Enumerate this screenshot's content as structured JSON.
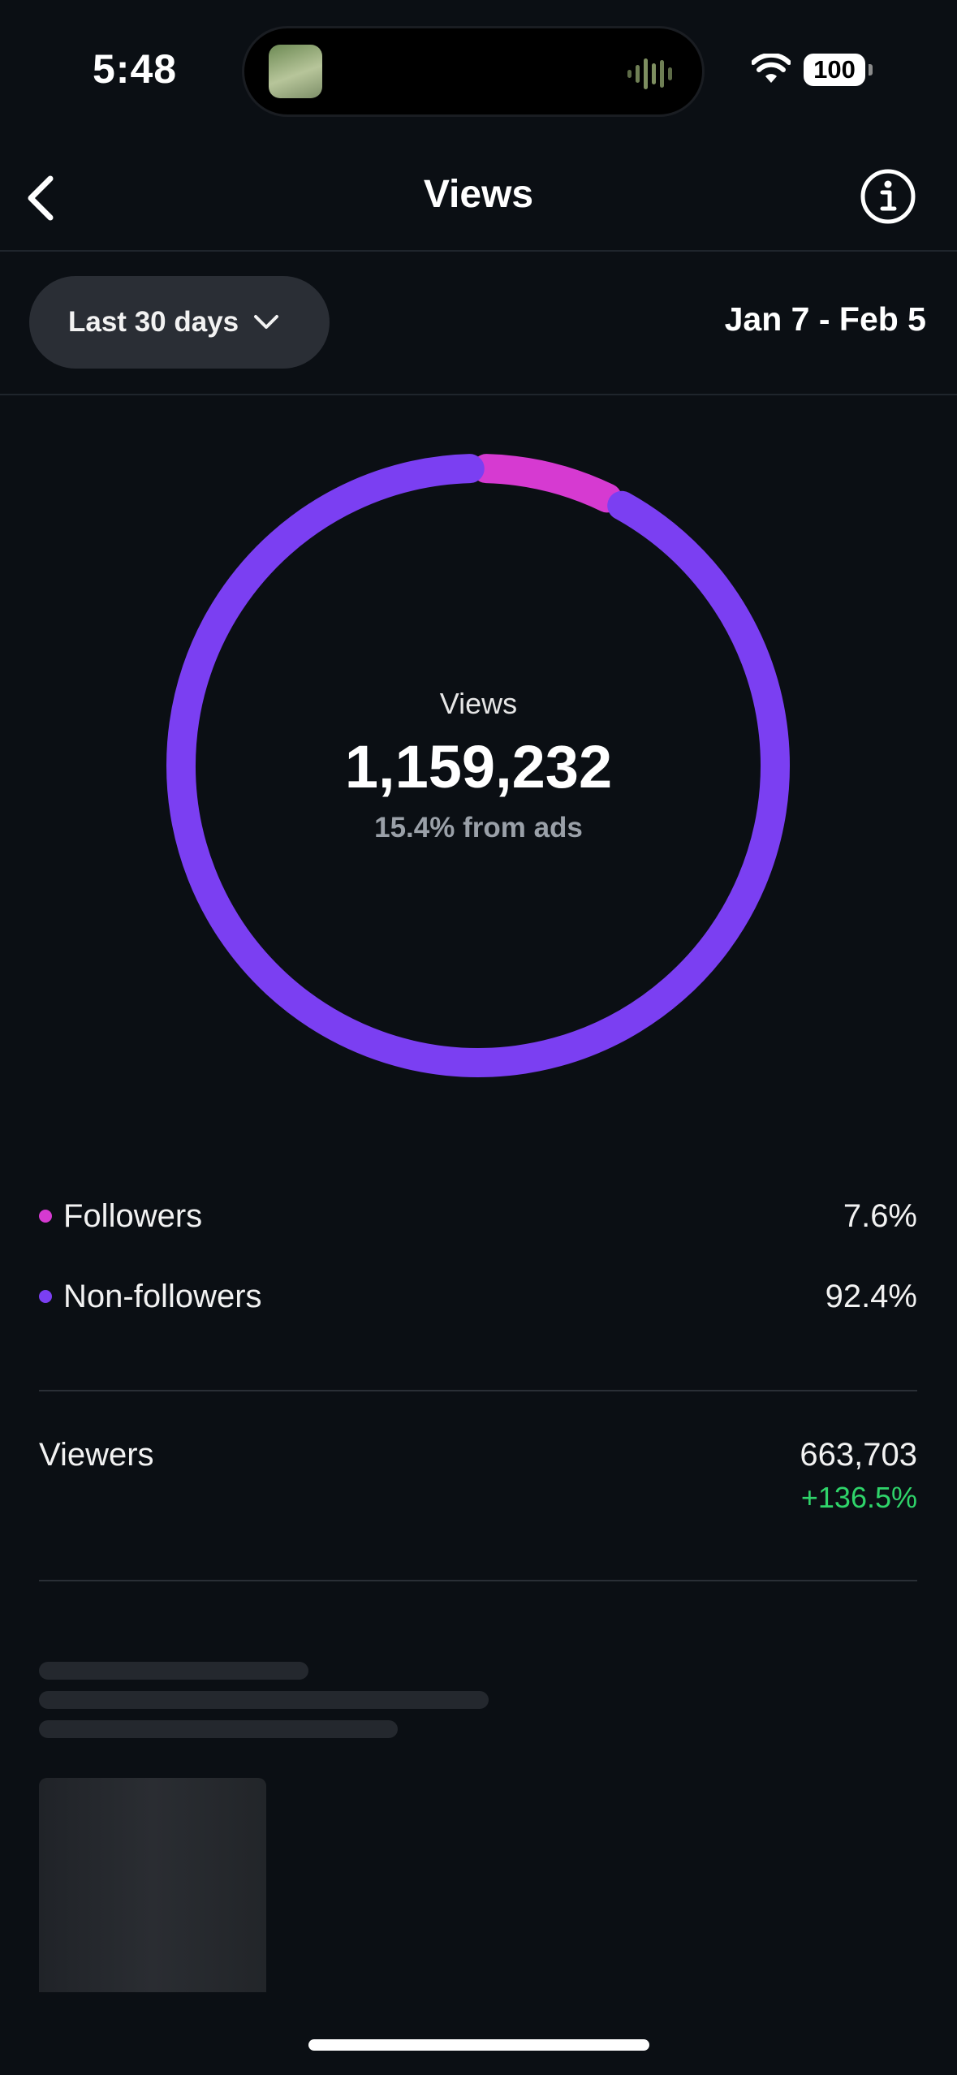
{
  "status_bar": {
    "time": "5:48",
    "battery": "100"
  },
  "header": {
    "title": "Views"
  },
  "filter": {
    "range_label": "Last 30 days",
    "date_range": "Jan 7 - Feb 5"
  },
  "summary": {
    "label": "Views",
    "total": "1,159,232",
    "ads_note": "15.4% from ads"
  },
  "chart_data": {
    "type": "pie",
    "categories": [
      "Followers",
      "Non-followers"
    ],
    "values": [
      7.6,
      92.4
    ],
    "colors": [
      "#d63ad1",
      "#7b3ff2"
    ]
  },
  "legend": [
    {
      "label": "Followers",
      "percent": "7.6%",
      "color": "#d63ad1"
    },
    {
      "label": "Non-followers",
      "percent": "92.4%",
      "color": "#7b3ff2"
    }
  ],
  "viewers": {
    "label": "Viewers",
    "value": "663,703",
    "change": "+136.5%"
  },
  "icons": {
    "back": "chevron-left-icon",
    "info": "info-icon",
    "dropdown": "chevron-down-icon",
    "wifi": "wifi-icon",
    "battery": "battery-icon"
  },
  "colors": {
    "background": "#0b0f14",
    "accent_green": "#2fd46a"
  }
}
